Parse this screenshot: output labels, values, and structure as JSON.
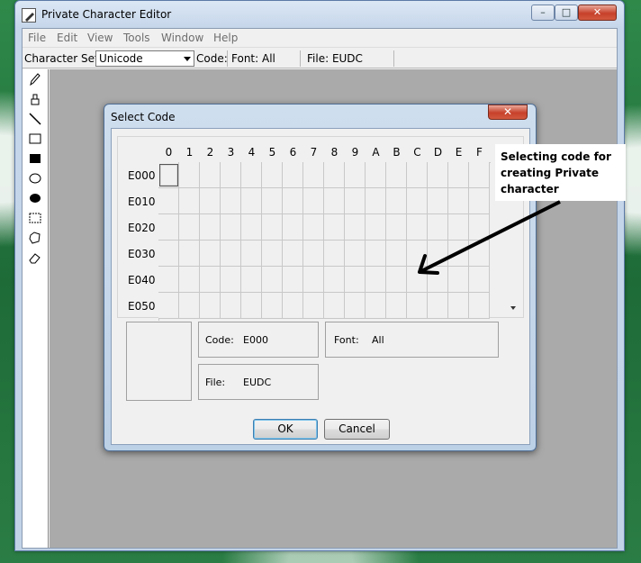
{
  "window": {
    "title": "Private Character Editor",
    "caption": {
      "minimize": "–",
      "maximize": "□",
      "close": "✕"
    }
  },
  "menu": [
    "File",
    "Edit",
    "View",
    "Tools",
    "Window",
    "Help"
  ],
  "charbar": {
    "charset_label": "Character Set:",
    "charset_value": "Unicode",
    "code_label": "Code:",
    "font_label": "Font: All",
    "file_label": "File: EUDC"
  },
  "tools": [
    "pencil-icon",
    "brush-icon",
    "line-icon",
    "hollow-rectangle-icon",
    "filled-rectangle-icon",
    "hollow-ellipse-icon",
    "filled-ellipse-icon",
    "rectangular-selection-icon",
    "freeform-selection-icon",
    "eraser-icon"
  ],
  "dialog": {
    "title": "Select Code",
    "close": "✕",
    "columns": [
      "0",
      "1",
      "2",
      "3",
      "4",
      "5",
      "6",
      "7",
      "8",
      "9",
      "A",
      "B",
      "C",
      "D",
      "E",
      "F"
    ],
    "rows": [
      "E000",
      "E010",
      "E020",
      "E030",
      "E040",
      "E050"
    ],
    "selected_code": "E000",
    "code_label": "Code:",
    "code_value": "E000",
    "font_label": "Font:",
    "font_value": "All",
    "file_label": "File:",
    "file_value": "EUDC",
    "ok": "OK",
    "cancel": "Cancel"
  },
  "annotation": {
    "text": "Selecting code for creating Private character"
  },
  "colors": {
    "workarea": "#aaaaaa",
    "client": "#f0f0f0",
    "close_button": "#c7402a",
    "frame": "#c2d3e8"
  }
}
